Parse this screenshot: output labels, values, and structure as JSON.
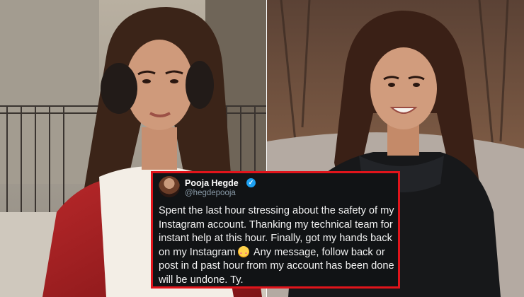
{
  "tweet": {
    "display_name": "Pooja Hegde",
    "handle": "@hegdepooja",
    "verified_icon": "verified-badge-icon",
    "text_part1": "Spent the last hour stressing about the safety of my Instagram account. Thanking my technical team for instant help at this hour. Finally, got my hands back on my Instagram",
    "emoji": "smiling-face-with-hearts-icon",
    "text_part2": " Any message, follow back or post in d past hour from my account has been done will be undone. Ty.",
    "border_color": "#e1141b"
  }
}
